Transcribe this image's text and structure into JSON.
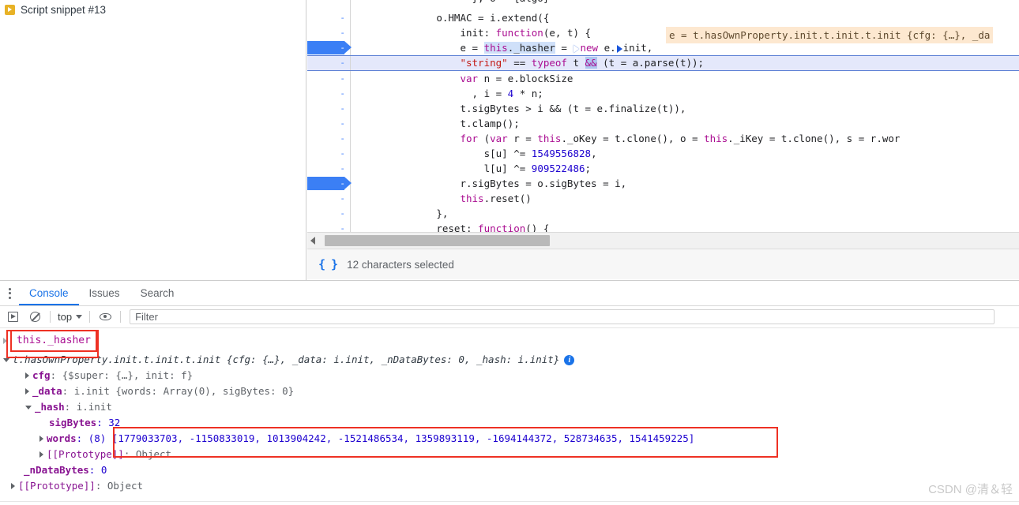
{
  "snippets": {
    "items": [
      {
        "label": "Script snippet #13",
        "icon": "snippet-play-icon"
      }
    ]
  },
  "editor": {
    "lines": [
      {
        "gutter": "-",
        "breakpoint": false,
        "selected": false,
        "partial": true,
        "text": "}, o = {algo}"
      },
      {
        "gutter": "-",
        "breakpoint": false,
        "selected": false,
        "text": "o.HMAC = i.extend({"
      },
      {
        "gutter": "-",
        "breakpoint": false,
        "selected": false,
        "text": "init: function(e, t) {"
      },
      {
        "gutter": "-",
        "breakpoint": true,
        "selected": false,
        "text": "e = this._hasher = new e.init,"
      },
      {
        "gutter": "-",
        "breakpoint": false,
        "selected": true,
        "text": "\"string\" == typeof t && (t = a.parse(t));"
      },
      {
        "gutter": "-",
        "breakpoint": false,
        "selected": false,
        "text": "var n = e.blockSize"
      },
      {
        "gutter": "-",
        "breakpoint": false,
        "selected": false,
        "text": ", i = 4 * n;"
      },
      {
        "gutter": "-",
        "breakpoint": false,
        "selected": false,
        "text": "t.sigBytes > i && (t = e.finalize(t)),"
      },
      {
        "gutter": "-",
        "breakpoint": false,
        "selected": false,
        "text": "t.clamp();"
      },
      {
        "gutter": "-",
        "breakpoint": false,
        "selected": false,
        "text": "for (var r = this._oKey = t.clone(), o = this._iKey = t.clone(), s = r.wor"
      },
      {
        "gutter": "-",
        "breakpoint": false,
        "selected": false,
        "text": "s[u] ^= 1549556828,"
      },
      {
        "gutter": "-",
        "breakpoint": false,
        "selected": false,
        "text": "l[u] ^= 909522486;"
      },
      {
        "gutter": "-",
        "breakpoint": true,
        "selected": false,
        "text": "r.sigBytes = o.sigBytes = i,"
      },
      {
        "gutter": "-",
        "breakpoint": false,
        "selected": false,
        "text": "this.reset()"
      },
      {
        "gutter": "-",
        "breakpoint": false,
        "selected": false,
        "text": "},"
      },
      {
        "gutter": "-",
        "breakpoint": false,
        "selected": false,
        "text": "reset: function() {"
      },
      {
        "gutter": "-",
        "breakpoint": false,
        "selected": false,
        "text": "var e = this._hasher;"
      }
    ],
    "tooltip": "e = t.hasOwnProperty.init.t.init.t.init {cfg: {…}, _da",
    "status": {
      "icon": "braces-icon",
      "text": "12 characters selected"
    },
    "scrollbar": {
      "icon": "left-arrow-icon"
    }
  },
  "drawer": {
    "tabs": [
      {
        "label": "Console",
        "active": true
      },
      {
        "label": "Issues",
        "active": false
      },
      {
        "label": "Search",
        "active": false
      }
    ],
    "kebab_icon": "more-options-icon",
    "toolbar": {
      "execute_icon": "execute-context-icon",
      "clear_icon": "clear-console-icon",
      "context": "top",
      "context_caret_icon": "chevron-down-icon",
      "eye_icon": "live-expression-icon",
      "filter_placeholder": "Filter"
    },
    "console": {
      "expression": "this._hasher",
      "result_header": "t.hasOwnProperty.init.t.init.t.init {cfg: {…}, _data: i.init, _nDataBytes: 0, _hash: i.init}",
      "info_badge": "i",
      "rows": [
        {
          "indent": 1,
          "arrow": "right",
          "key": "cfg",
          "value": ": {$super: {…}, init: f}"
        },
        {
          "indent": 1,
          "arrow": "right",
          "key": "_data",
          "value": ": i.init {words: Array(0), sigBytes: 0}"
        },
        {
          "indent": 1,
          "arrow": "down",
          "key": "_hash",
          "value": ": i.init"
        },
        {
          "indent": 2,
          "arrow": "none",
          "key": "sigBytes",
          "value": ": 32"
        },
        {
          "indent": 2,
          "arrow": "right",
          "key": "words",
          "value": ": (8) [1779033703, -1150833019, 1013904242, -1521486534, 1359893119, -1694144372, 528734635, 1541459225]"
        },
        {
          "indent": 2,
          "arrow": "right",
          "key": "[[Prototype]]",
          "value": ": Object"
        },
        {
          "indent": 1,
          "arrow": "none",
          "key": "_nDataBytes",
          "value": ": 0"
        },
        {
          "indent": 0,
          "arrow": "right",
          "key": "[[Prototype]]",
          "value": ": Object"
        }
      ]
    }
  },
  "annotations": {
    "expression_box": "this._hasher",
    "words_box": "[1779033703, -1150833019, 1013904242, -1521486534, 1359893119, -1694144372, 528734635, 1541459225]"
  },
  "watermark": "CSDN @清＆轻",
  "colors": {
    "accent": "#1a73e8",
    "breakpoint": "#3b7ff5",
    "annotation": "#ee3124",
    "keyword": "#aa0d91",
    "string": "#c41a16",
    "number": "#1c00cf"
  }
}
